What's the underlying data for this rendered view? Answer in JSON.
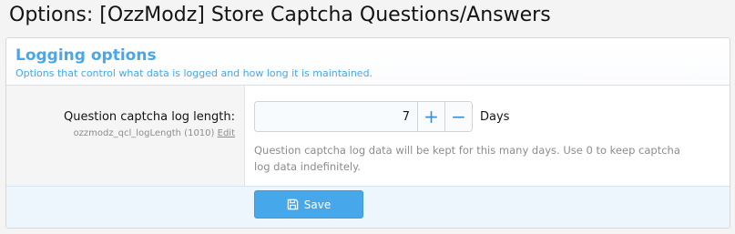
{
  "page": {
    "title": "Options: [OzzModz] Store Captcha Questions/Answers"
  },
  "section": {
    "title": "Logging options",
    "description": "Options that control what data is logged and how long it is maintained."
  },
  "option": {
    "label": "Question captcha log length:",
    "hint": "ozzmodz_qcl_logLength (1010)",
    "edit_label": "Edit",
    "value": "7",
    "increment_label": "+",
    "decrement_label": "−",
    "units": "Days",
    "explain": "Question captcha log data will be kept for this many days. Use 0 to keep captcha log data indefinitely."
  },
  "actions": {
    "save_label": "Save",
    "save_icon": "save-icon"
  },
  "colors": {
    "accent": "#47a7eb",
    "footer_bg": "#edf6fd"
  }
}
